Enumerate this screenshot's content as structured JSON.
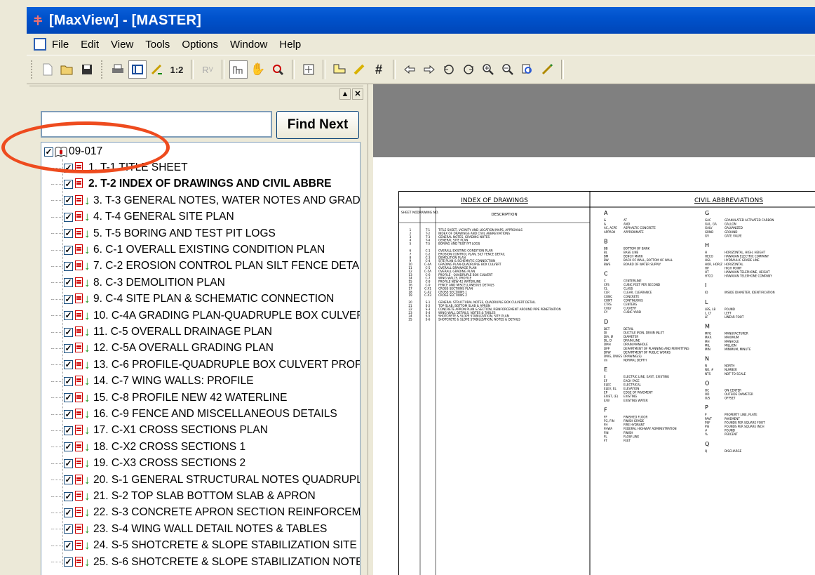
{
  "window": {
    "title": "[MaxView] - [MASTER]"
  },
  "menu": [
    "File",
    "Edit",
    "View",
    "Tools",
    "Options",
    "Window",
    "Help"
  ],
  "toolbar": {
    "zoom_label": "1:2",
    "hash_label": "#"
  },
  "search": {
    "value": "",
    "find_next_label": "Find Next"
  },
  "tree": {
    "root": "09-017",
    "items": [
      {
        "label": "1. T-1 TITLE SHEET",
        "selected": false
      },
      {
        "label": "2. T-2 INDEX OF DRAWINGS AND CIVIL ABBRE",
        "selected": true
      },
      {
        "label": "3. T-3 GENERAL NOTES, WATER NOTES AND GRAD:"
      },
      {
        "label": "4. T-4 GENERAL SITE PLAN"
      },
      {
        "label": "5. T-5 BORING AND TEST PIT LOGS"
      },
      {
        "label": "6. C-1 OVERALL EXISTING CONDITION PLAN"
      },
      {
        "label": "7. C-2 EROSION CONTROL PLAN SILT FENCE DETAI"
      },
      {
        "label": "8. C-3 DEMOLITION PLAN"
      },
      {
        "label": "9. C-4 SITE PLAN & SCHEMATIC CONNECTION"
      },
      {
        "label": "10. C-4A GRADING PLAN-QUADRUPLE BOX CULVER"
      },
      {
        "label": "11. C-5 OVERALL DRAINAGE PLAN"
      },
      {
        "label": "12. C-5A OVERALL GRADING PLAN"
      },
      {
        "label": "13. C-6 PROFILE-QUADRUPLE BOX CULVERT PROFI"
      },
      {
        "label": "14. C-7 WING WALLS: PROFILE"
      },
      {
        "label": "15. C-8 PROFILE NEW 42 WATERLINE"
      },
      {
        "label": "16. C-9 FENCE AND MISCELLANEOUS DETAILS"
      },
      {
        "label": "17. C-X1 CROSS SECTIONS PLAN"
      },
      {
        "label": "18. C-X2 CROSS SECTIONS 1"
      },
      {
        "label": "19. C-X3 CROSS SECTIONS 2"
      },
      {
        "label": "20. S-1 GENERAL STRUCTURAL NOTES QUADRUPLE"
      },
      {
        "label": "21. S-2 TOP SLAB BOTTOM SLAB & APRON"
      },
      {
        "label": "22. S-3 CONCRETE APRON SECTION REINFORCEME"
      },
      {
        "label": "23. S-4 WING WALL DETAIL NOTES & TABLES"
      },
      {
        "label": "24. S-5 SHOTCRETE & SLOPE STABILIZATION SITE"
      },
      {
        "label": "25. S-6 SHOTCRETE & SLOPE STABILIZATION NOTE"
      }
    ]
  },
  "drawing": {
    "index_title": "INDEX OF DRAWINGS",
    "abbrev_title": "CIVIL ABBREVIATIONS",
    "col_sheet": "SHEET NO.",
    "col_drawing": "DRAWING NO.",
    "col_desc": "DESCRIPTION",
    "index_rows": [
      [
        "1",
        "T-1",
        "TITLE SHEET, VICINITY AND LOCATION MAPS, APPROVALS"
      ],
      [
        "2",
        "T-2",
        "INDEX OF DRAWINGS AND CIVIL ABBREVIATIONS"
      ],
      [
        "3",
        "T-3",
        "GENERAL NOTES, GRADING NOTES"
      ],
      [
        "4",
        "T-4",
        "GENERAL SITE PLAN"
      ],
      [
        "5",
        "T-5",
        "BORING AND TEST PIT LOGS"
      ],
      [
        "6",
        "C-1",
        "OVERALL EXISTING CONDITION PLAN"
      ],
      [
        "7",
        "C-2",
        "EROSION CONTROL PLAN, SILT FENCE DETAIL"
      ],
      [
        "8",
        "C-3",
        "DEMOLITION PLAN"
      ],
      [
        "9",
        "C-4",
        "SITE PLAN & SCHEMATIC CONNECTION"
      ],
      [
        "10",
        "C-4A",
        "GRADING PLAN-QUADRUPLE BOX CULVERT"
      ],
      [
        "11",
        "C-5",
        "OVERALL DRAINAGE PLAN"
      ],
      [
        "12",
        "C-5A",
        "OVERALL GRADING PLAN"
      ],
      [
        "13",
        "C-6",
        "PROFILE - QUADRUPLE BOX CULVERT"
      ],
      [
        "14",
        "C-7",
        "WING WALLS, PROFILE"
      ],
      [
        "15",
        "C-8",
        "PROFILE NEW 42 WATERLINE"
      ],
      [
        "16",
        "C-9",
        "FENCE AND MISCELLANEOUS DETAILS"
      ],
      [
        "17",
        "C-X1",
        "CROSS SECTIONS PLAN"
      ],
      [
        "18",
        "C-X2",
        "CROSS SECTIONS 1"
      ],
      [
        "19",
        "C-X3",
        "CROSS SECTIONS 2"
      ],
      [
        "20",
        "S-1",
        "GENERAL STRUCTURAL NOTES, QUADRUPLE BOX CULVERT DETAIL"
      ],
      [
        "21",
        "S-2",
        "TOP SLAB, BOTTOM SLAB & APRON"
      ],
      [
        "22",
        "S-3",
        "CONCRETE APRON PLAN & SECTION, REINFORCEMENT AROUND PIPE PENETRATION"
      ],
      [
        "23",
        "S-4",
        "WING WALL DETAILS, NOTES & TABLES"
      ],
      [
        "24",
        "S-5",
        "SHOTCRETE & SLOPE STABILIZATION, SITE PLAN"
      ],
      [
        "25",
        "S-6",
        "SHOTCRETE & SLOPE STABILIZATION, NOTES & DETAILS"
      ]
    ],
    "abbrev_left": [
      {
        "letter": "A",
        "rows": [
          [
            "&",
            "AT"
          ],
          [
            "&",
            "AND"
          ],
          [
            "AC, ACPE",
            "ASPHALTIC CONCRETE"
          ],
          [
            "APPROX",
            "APPROXIMATE"
          ]
        ]
      },
      {
        "letter": "B",
        "rows": [
          [
            "BB",
            "BOTTOM OF BANK"
          ],
          [
            "BL",
            "BASE LINE"
          ],
          [
            "BM",
            "BENCH MARK"
          ],
          [
            "BW",
            "BACK OF WALL, BOTTOM OF WALL"
          ],
          [
            "BWS",
            "BOARD OF WATER SUPPLY"
          ]
        ]
      },
      {
        "letter": "C",
        "rows": [
          [
            "C",
            "CENTERLINE"
          ],
          [
            "CFS",
            "CUBIC FEET PER SECOND"
          ],
          [
            "CL",
            "CLASS"
          ],
          [
            "CLR",
            "CLEAR, CLEARANCE"
          ],
          [
            "CONC",
            "CONCRETE"
          ],
          [
            "CONT",
            "CONTINUOUS"
          ],
          [
            "CTRS",
            "CENTERS"
          ],
          [
            "CULV",
            "CULVERT"
          ],
          [
            "CY",
            "CUBIC YARD"
          ]
        ]
      },
      {
        "letter": "D",
        "rows": [
          [
            "DET",
            "DETAIL"
          ],
          [
            "DI",
            "DUCTILE IRON, DRAIN INLET"
          ],
          [
            "DIA, Ø",
            "DIAMETER"
          ],
          [
            "DL, D",
            "DRAIN LINE"
          ],
          [
            "DMH",
            "DRAIN MANHOLE"
          ],
          [
            "DPP",
            "DEPARTMENT OF PLANNING AND PERMITTING"
          ],
          [
            "DPW",
            "DEPARTMENT OF PUBLIC WORKS"
          ],
          [
            "DWG, DWGS",
            "DRAWING(S)"
          ],
          [
            "dn",
            "NORMAL DEPTH"
          ]
        ]
      },
      {
        "letter": "E",
        "rows": [
          [
            "E",
            "ELECTRIC LINE, EAST, EXISTING"
          ],
          [
            "EF",
            "EACH FACE"
          ],
          [
            "ELEC",
            "ELECTRICAL"
          ],
          [
            "ELEV, EL",
            "ELEVATION"
          ],
          [
            "EP",
            "EDGE OF PAVEMENT"
          ],
          [
            "EXIST, (E)",
            "EXISTING"
          ],
          [
            "E/W",
            "EXISTING WATER"
          ]
        ]
      },
      {
        "letter": "F",
        "rows": [
          [
            "FF",
            "FINISHED FLOOR"
          ],
          [
            "FG, FIN",
            "FINISH GRADE"
          ],
          [
            "FH",
            "FIRE HYDRANT"
          ],
          [
            "FHWA",
            "FEDERAL HIGHWAY ADMINISTRATION"
          ],
          [
            "FIN",
            "FINISH"
          ],
          [
            "FL",
            "FLOW LINE"
          ],
          [
            "FT",
            "FEET"
          ]
        ]
      }
    ],
    "abbrev_right": [
      {
        "letter": "G",
        "rows": [
          [
            "GAC",
            "GRANULATED ACTIVATED CARBON"
          ],
          [
            "GAL, GA",
            "GALLON"
          ],
          [
            "GALV",
            "GALVANIZED"
          ],
          [
            "GRND",
            "GROUND"
          ],
          [
            "GV",
            "GATE VALVE"
          ]
        ]
      },
      {
        "letter": "H",
        "rows": [
          [
            "H",
            "HORIZONTAL, HIGH, HEIGHT"
          ],
          [
            "HECO",
            "HAWAIIAN ELECTRIC COMPANY"
          ],
          [
            "HGL",
            "HYDRAULIC GRADE LINE"
          ],
          [
            "HOR, HORIZ",
            "HORIZONTAL"
          ],
          [
            "HP",
            "HIGH POINT"
          ],
          [
            "HT",
            "HAWAIIAN TELEPHONE, HEIGHT"
          ],
          [
            "HTCO",
            "HAWAIIAN TELEPHONE COMPANY"
          ]
        ]
      },
      {
        "letter": "I",
        "rows": [
          [
            "ID",
            "INSIDE DIAMETER, IDENTIFICATION"
          ]
        ]
      },
      {
        "letter": "L",
        "rows": [
          [
            "LBS, LB",
            "POUND"
          ],
          [
            "L, LT",
            "LEFT"
          ],
          [
            "LF",
            "LINEAR FOOT"
          ]
        ]
      },
      {
        "letter": "M",
        "rows": [
          [
            "MFG",
            "MANUFACTURER"
          ],
          [
            "MAX.",
            "MAXIMUM"
          ],
          [
            "MH",
            "MANHOLE"
          ],
          [
            "MIL",
            "MILLION"
          ],
          [
            "MIN",
            "MINIMUM, MINUTE"
          ]
        ]
      },
      {
        "letter": "N",
        "rows": [
          [
            "N",
            "NORTH"
          ],
          [
            "NO, #",
            "NUMBER"
          ],
          [
            "NTS",
            "NOT TO SCALE"
          ]
        ]
      },
      {
        "letter": "O",
        "rows": [
          [
            "OC",
            "ON CENTER"
          ],
          [
            "OD",
            "OUTSIDE DIAMETER"
          ],
          [
            "O/S",
            "OFFSET"
          ]
        ]
      },
      {
        "letter": "P",
        "rows": [
          [
            "P",
            "PROPERTY LINE, PLATE"
          ],
          [
            "PAVT",
            "PAVEMENT"
          ],
          [
            "PSF",
            "POUNDS PER SQUARE FOOT"
          ],
          [
            "PSI",
            "POUNDS PER SQUARE INCH"
          ],
          [
            "#",
            "POUND"
          ],
          [
            "%",
            "PERCENT"
          ]
        ]
      },
      {
        "letter": "Q",
        "rows": [
          [
            "Q",
            "DISCHARGE"
          ]
        ]
      }
    ]
  }
}
